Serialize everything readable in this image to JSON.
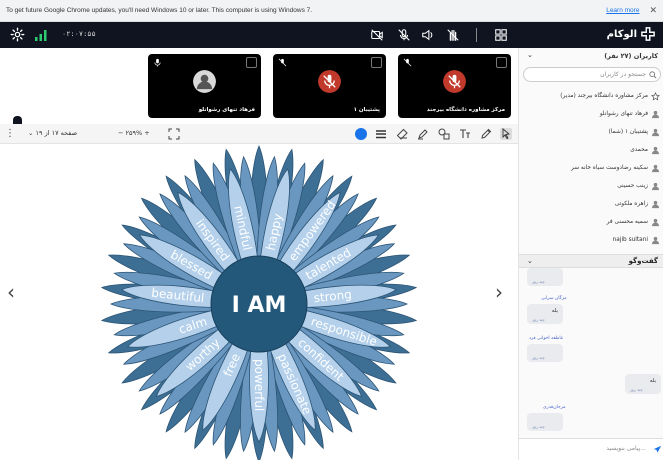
{
  "chrome_notice": {
    "message": "To get future Google Chrome updates, you'll need Windows 10 or later. This computer is using Windows 7.",
    "learn_more": "Learn more",
    "close": "✕"
  },
  "topbar": {
    "timer": "۰۲:۰۷:۵۵",
    "logo_text": "الوکام",
    "colors": {
      "background": "#0f1420",
      "signal": "#2ecc71"
    }
  },
  "video_tiles": [
    {
      "label": "فرهاد تنهای رشوانلو",
      "mic": "mic-on",
      "avatar": "user-avatar"
    },
    {
      "label": "پشتیبان ۱",
      "mic": "mic-off",
      "avatar": "muted-mic"
    },
    {
      "label": "مرکز مشاوره دانشگاه بیرجند",
      "mic": "mic-off",
      "avatar": "muted-mic"
    }
  ],
  "toolbar": {
    "page_label": "صفحه ۱۷ از ۱۹",
    "zoom_label": "۲۵۹%",
    "zoom_out": "−",
    "zoom_in": "+",
    "active_color": "#1a73e8"
  },
  "whiteboard": {
    "center_text": "I AM",
    "petal_words": [
      "happy",
      "empowered",
      "talented",
      "strong",
      "responsible",
      "confident",
      "passionate",
      "powerful",
      "free",
      "worthy",
      "calm",
      "beautiful",
      "blessed",
      "inspired",
      "mindful"
    ],
    "colors": {
      "dark": "#3d6e94",
      "mid": "#6a97c0",
      "light": "#b4d0eb",
      "center": "#23587a"
    }
  },
  "sidebar": {
    "users_header": "کاربران (۲۷ نفر)",
    "search_placeholder": "جستجو در کاربران",
    "users": [
      "مرکز مشاوره دانشگاه بیرجند (مدیر)",
      "فرهاد تنهای رشوانلو",
      "پشتیبان ۱ (شما)",
      "محمدی",
      "سکینه رضادوست سیاه خانه سر",
      "زینب حسینی",
      "زاهره ملکوتی",
      "سمیه محسنی فر",
      "najib sultani"
    ],
    "chat_header": "گفت‌وگو",
    "chat_placeholder": "پیامی بنویسید...",
    "chat_messages": [
      {
        "sender": "",
        "text": "",
        "time": "چند روز"
      },
      {
        "sender": "مژگان سرایی",
        "text": "بله",
        "time": "چند روز"
      },
      {
        "sender": "عاطفه اخوانی فرد",
        "text": "",
        "time": "چند روز"
      },
      {
        "sender": "",
        "text": "بله",
        "time": "چند روز"
      },
      {
        "sender": "مرجان‌قدری",
        "text": "",
        "time": "چند روز"
      }
    ]
  }
}
